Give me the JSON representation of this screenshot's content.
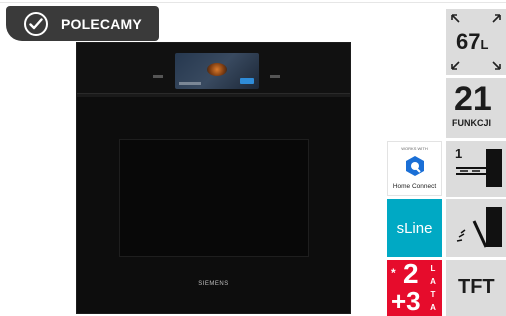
{
  "badge": {
    "label": "POLECAMY",
    "icon": "check-circle-icon"
  },
  "oven": {
    "brand": "SIEMENS"
  },
  "features": {
    "capacity": {
      "value": "67",
      "unit": "L"
    },
    "functions": {
      "value": "21",
      "label": "FUNKCJI"
    },
    "home_connect": {
      "top_text": "WORKS WITH",
      "name": "Home Connect",
      "accent": "#1a6fd6"
    },
    "shelf_level": {
      "value": "1"
    },
    "sline": {
      "label": "sLine",
      "color": "#00a9c4"
    },
    "warranty": {
      "star": "*",
      "a": "2",
      "b": "+3",
      "word": [
        "L",
        "A",
        "T",
        "A"
      ],
      "color": "#e60c2c"
    },
    "display": {
      "label": "TFT"
    }
  }
}
